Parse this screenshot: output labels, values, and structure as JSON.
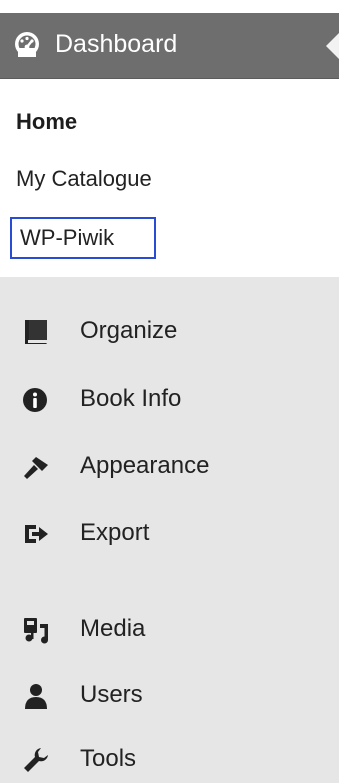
{
  "dashboard": {
    "icon": "gauge-icon",
    "label": "Dashboard"
  },
  "submenu": {
    "items": [
      {
        "label": "Home",
        "current": true
      },
      {
        "label": "My Catalogue"
      },
      {
        "label": "WP-Piwik",
        "highlighted": true
      }
    ]
  },
  "menu": {
    "items": [
      {
        "icon": "book-icon",
        "label": "Organize"
      },
      {
        "icon": "info-icon",
        "label": "Book Info"
      },
      {
        "icon": "paintbrush-icon",
        "label": "Appearance"
      },
      {
        "icon": "export-icon",
        "label": "Export"
      },
      {
        "icon": "media-icon",
        "label": "Media"
      },
      {
        "icon": "user-icon",
        "label": "Users"
      },
      {
        "icon": "wrench-icon",
        "label": "Tools"
      }
    ]
  },
  "colors": {
    "dashboard_bg": "#6e6e6e",
    "menu_bg": "#e6e6e6",
    "highlight_border": "#2a4bd4"
  }
}
